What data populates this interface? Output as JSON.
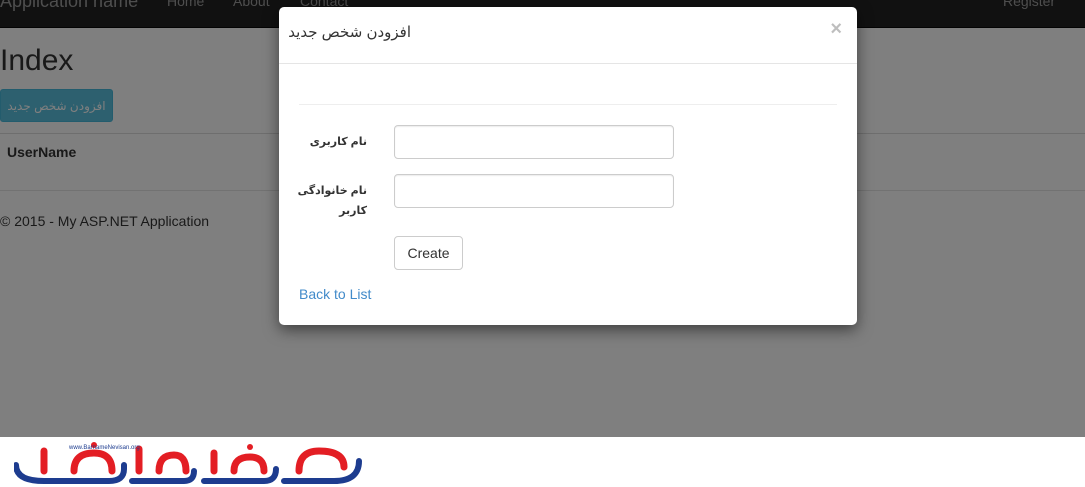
{
  "navbar": {
    "brand": "Application name",
    "links": [
      "Home",
      "About",
      "Contact"
    ],
    "register": "Register",
    "bg_color": "#222222"
  },
  "page": {
    "title": "Index",
    "add_button_label": "افزودن شخص جدید",
    "table_header_username": "UserName",
    "footer": "© 2015 - My ASP.NET Application"
  },
  "modal": {
    "title": "افزودن شخص جدید",
    "close_icon": "×",
    "fields": [
      {
        "label": "نام کاربری",
        "value": ""
      },
      {
        "label": "نام خانوادگی کاربر",
        "value": ""
      }
    ],
    "create_label": "Create",
    "back_link": "Back to List"
  },
  "watermark": {
    "url_text": "www.BarnameNevisan.org",
    "logo_text": "برنامه نویسان",
    "colors": {
      "red": "#e31e24",
      "blue": "#1d3c8f"
    }
  }
}
